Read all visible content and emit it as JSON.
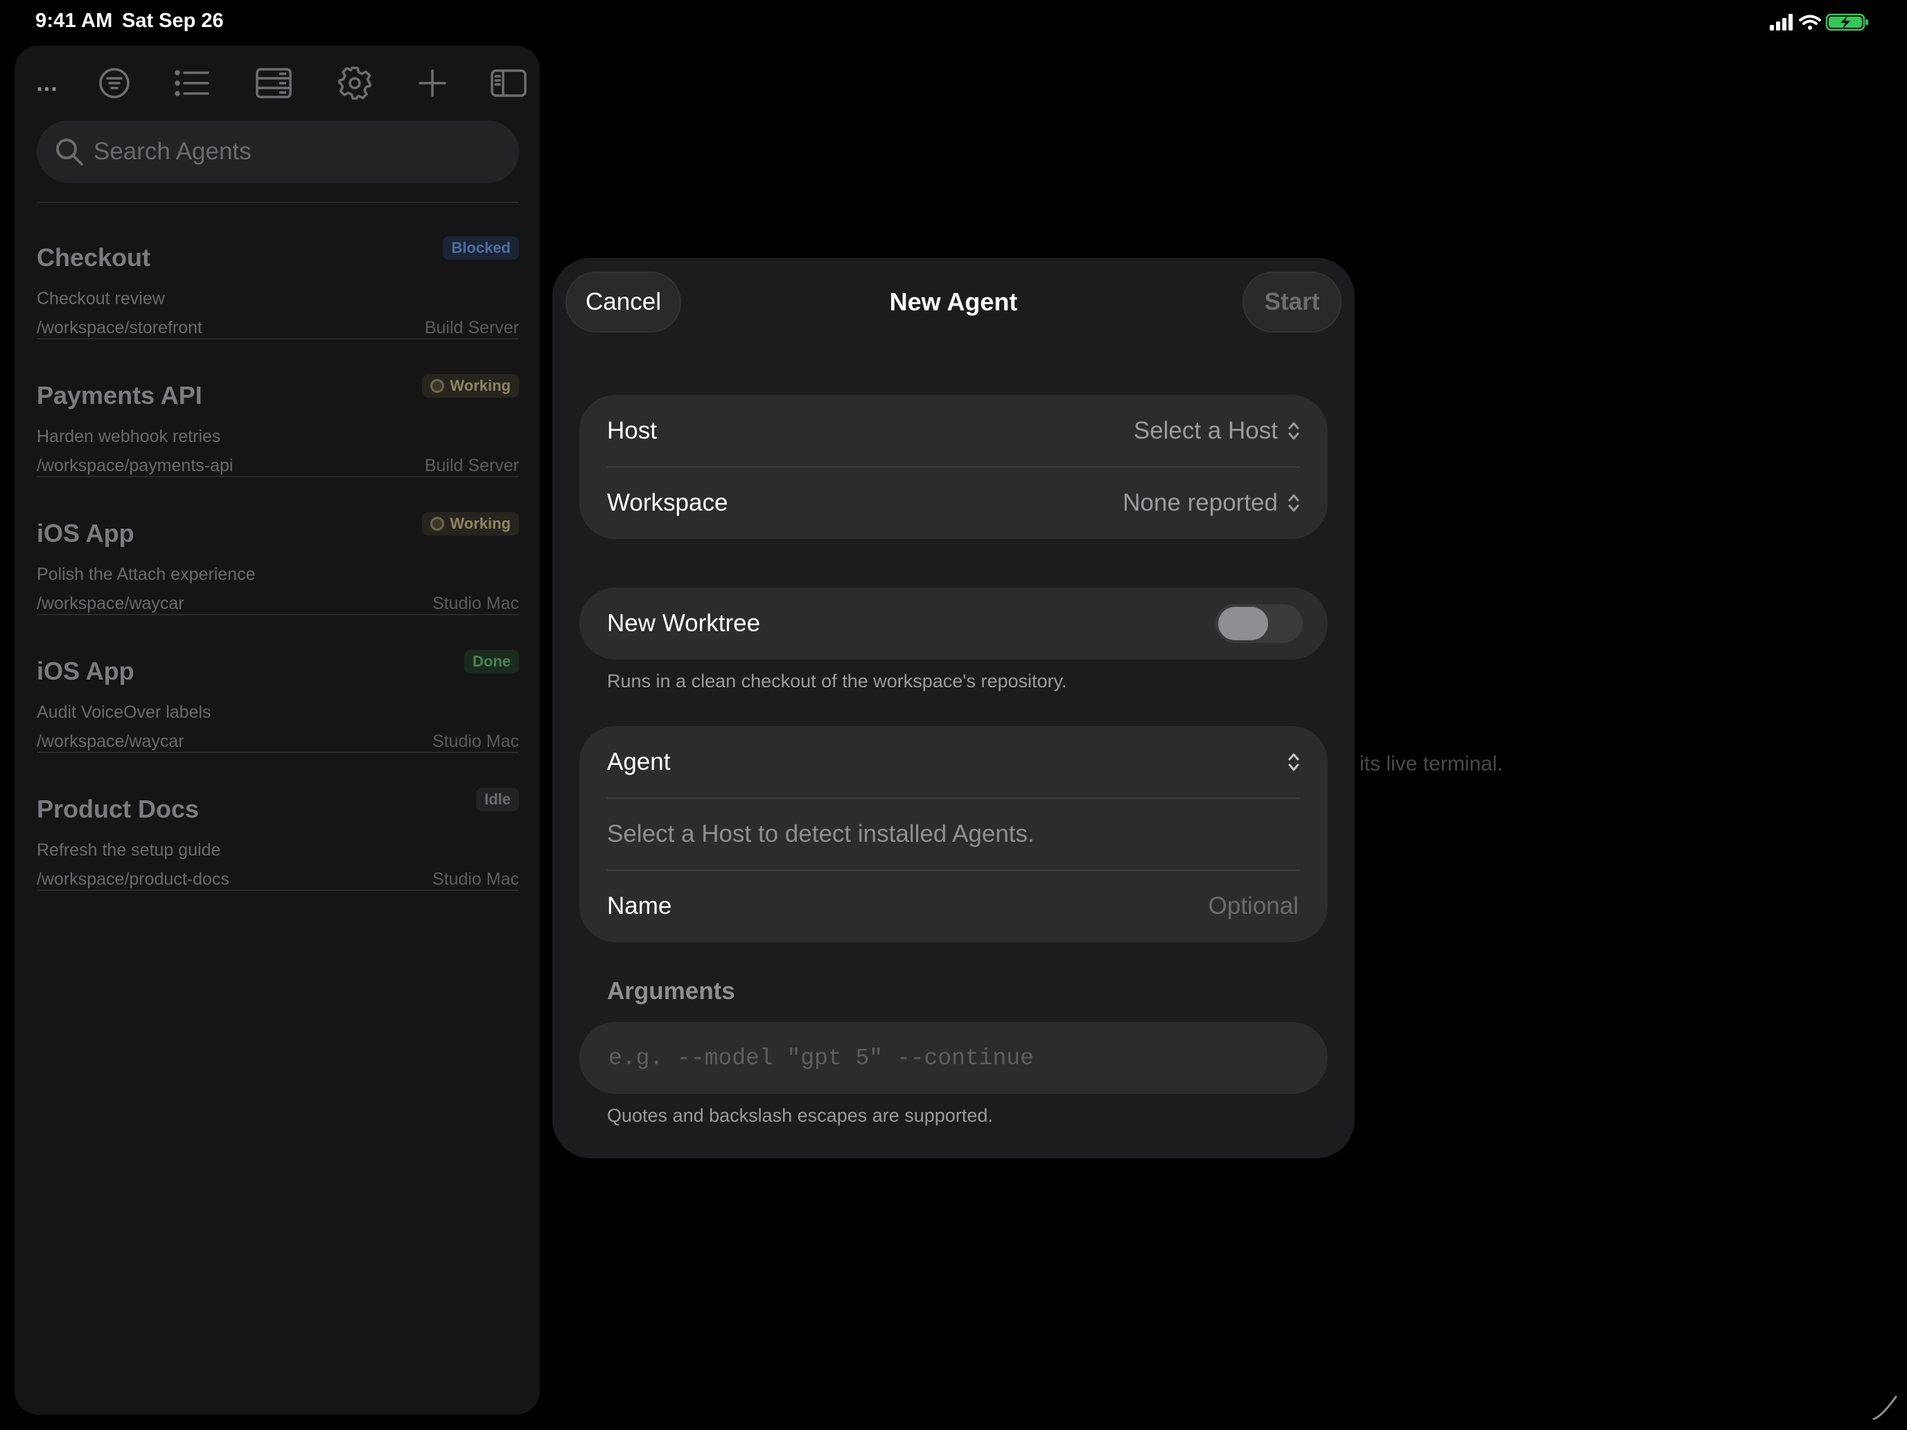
{
  "status_bar": {
    "time": "9:41 AM",
    "date": "Sat Sep 26"
  },
  "sidebar": {
    "toolbar": {
      "more": "...",
      "icons": [
        "ellipsis-icon",
        "filter-icon",
        "list-icon",
        "server-icon",
        "gear-icon",
        "plus-icon",
        "sidebar-toggle-icon"
      ]
    },
    "search": {
      "placeholder": "Search Agents",
      "value": ""
    },
    "agents": [
      {
        "title": "Checkout",
        "subtitle": "Checkout review",
        "path": "/workspace/storefront",
        "host": "Build Server",
        "status": "Blocked"
      },
      {
        "title": "Payments API",
        "subtitle": "Harden webhook retries",
        "path": "/workspace/payments-api",
        "host": "Build Server",
        "status": "Working"
      },
      {
        "title": "iOS App",
        "subtitle": "Polish the Attach experience",
        "path": "/workspace/waycar",
        "host": "Studio Mac",
        "status": "Working"
      },
      {
        "title": "iOS App",
        "subtitle": "Audit VoiceOver labels",
        "path": "/workspace/waycar",
        "host": "Studio Mac",
        "status": "Done"
      },
      {
        "title": "Product Docs",
        "subtitle": "Refresh the setup guide",
        "path": "/workspace/product-docs",
        "host": "Studio Mac",
        "status": "Idle"
      }
    ]
  },
  "background": {
    "hint_fragment": "its live terminal."
  },
  "modal": {
    "title": "New Agent",
    "cancel_label": "Cancel",
    "start_label": "Start",
    "host": {
      "label": "Host",
      "value": "Select a Host"
    },
    "workspace": {
      "label": "Workspace",
      "value": "None reported"
    },
    "worktree": {
      "label": "New Worktree",
      "enabled": false,
      "footnote": "Runs in a clean checkout of the workspace's repository."
    },
    "agent": {
      "label": "Agent",
      "hint": "Select a Host to detect installed Agents."
    },
    "name": {
      "label": "Name",
      "placeholder": "Optional",
      "value": ""
    },
    "arguments": {
      "label": "Arguments",
      "placeholder": "e.g. --model \"gpt 5\" --continue",
      "value": "",
      "footnote": "Quotes and backslash escapes are supported."
    }
  },
  "colors": {
    "background": "#000000",
    "sidebar": "#151516",
    "modal": "#1c1c1e",
    "group": "#2c2c2e",
    "blocked": "#4e6ea3",
    "working": "#8f8464",
    "done": "#4b8252",
    "battery": "#34c759"
  }
}
